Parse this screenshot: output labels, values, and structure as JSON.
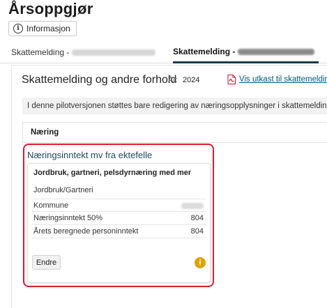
{
  "app": {
    "title": "Årsoppgjør"
  },
  "info_button": {
    "label": "Informasjon",
    "icon": "info-circle-icon"
  },
  "tabs": [
    {
      "label": "Skattemelding -",
      "active": false
    },
    {
      "label": "Skattemelding -",
      "active": true
    }
  ],
  "section": {
    "title": "Skattemelding og andre forhold",
    "year_label": "År:",
    "year_value": "2024",
    "draft_link": "Vis utkast til skattemelding",
    "draft_icon": "pdf-icon"
  },
  "notice": {
    "text": "I denne pilotversjonen støttes bare redigering av næringsopplysninger i skattemeldingen, se o"
  },
  "naering": {
    "header": "Næring"
  },
  "income": {
    "title": "Næringsinntekt mv fra ektefelle",
    "card": {
      "heading": "Jordbruk, gartneri, pelsdyrnæring med mer",
      "subheading": "Jordbruk/Gartneri",
      "rows": [
        {
          "label": "Kommune",
          "value": ""
        },
        {
          "label": "Næringsinntekt 50%",
          "value": "804"
        },
        {
          "label": "Årets beregnede personinntekt",
          "value": "804"
        }
      ],
      "edit_label": "Endre",
      "status_icon": "info-warning-icon"
    }
  },
  "colors": {
    "accent_dark": "#1d3b4f",
    "link": "#00587a",
    "highlight": "#e01a2b",
    "warning": "#e0a300"
  }
}
